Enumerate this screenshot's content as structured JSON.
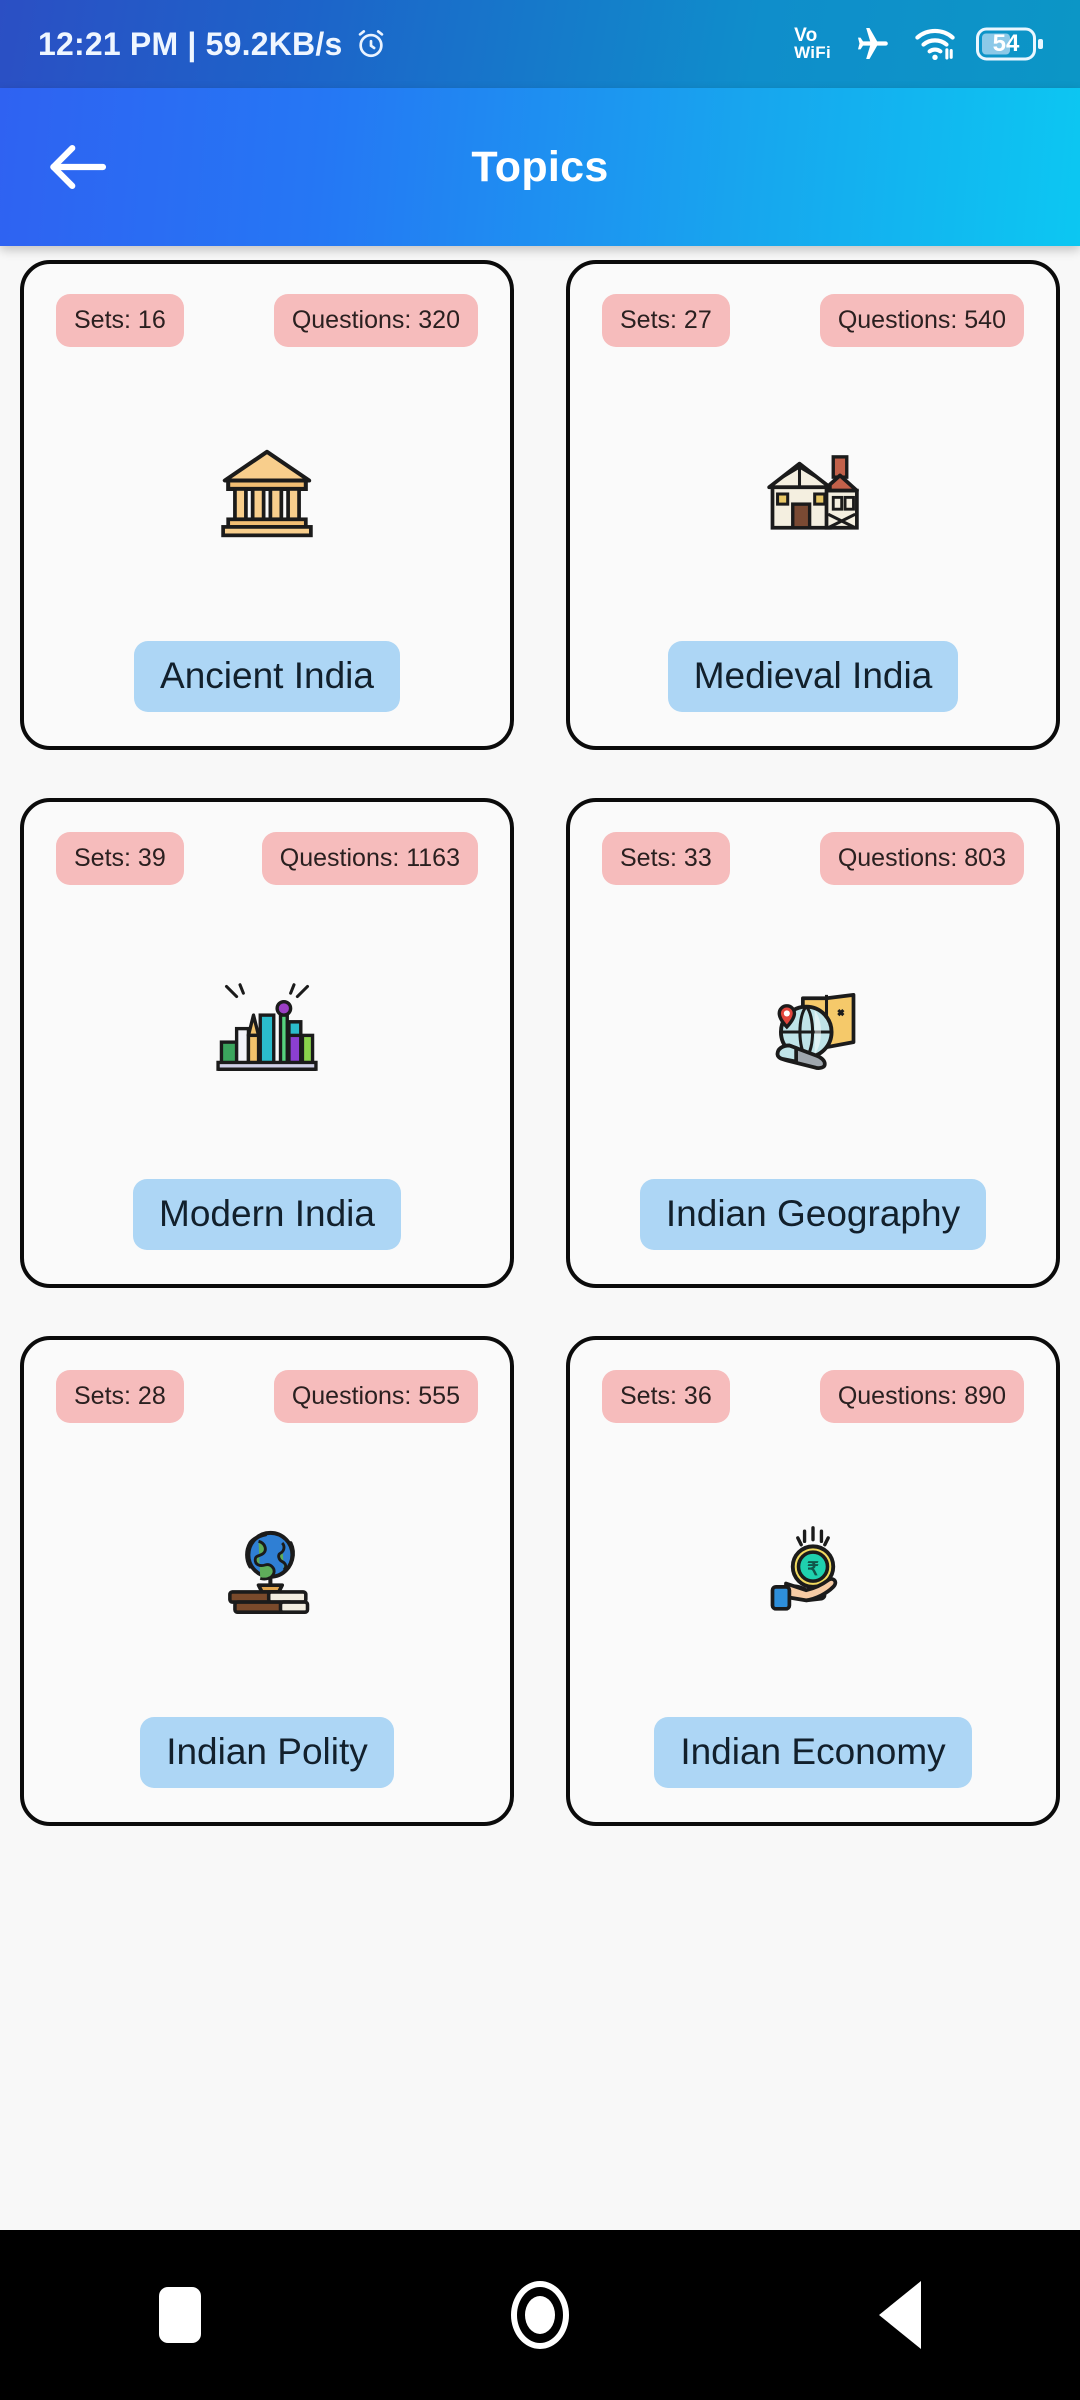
{
  "status_bar": {
    "time_and_speed": "12:21 PM | 59.2KB/s",
    "alarm_icon": "alarm-clock-icon",
    "vowifi_line1": "Vo",
    "vowifi_line2": "WiFi",
    "airplane_icon": "airplane-mode-icon",
    "wifi_icon": "wifi-icon",
    "battery_level": "54",
    "bg_color": "#1D63C9"
  },
  "app_bar": {
    "back_icon": "arrow-left-icon",
    "title": "Topics",
    "gradient_start": "#2F62F2",
    "gradient_end": "#0CC7F2"
  },
  "theme": {
    "page_bg": "#F8F8F8",
    "card_bg": "#FAFAFA",
    "card_border": "#0B0B0B",
    "stat_pill_bg": "#F6BCBC",
    "name_pill_bg": "#ADD6F5",
    "nav_bar_bg": "#000000"
  },
  "topics": [
    {
      "sets_label": "Sets: 16",
      "questions_label": "Questions: 320",
      "name": "Ancient India",
      "icon": "classical-building-icon"
    },
    {
      "sets_label": "Sets: 27",
      "questions_label": "Questions: 540",
      "name": "Medieval India",
      "icon": "medieval-house-icon"
    },
    {
      "sets_label": "Sets: 39",
      "questions_label": "Questions: 1163",
      "name": "Modern India",
      "icon": "city-skyline-icon"
    },
    {
      "sets_label": "Sets: 33",
      "questions_label": "Questions: 803",
      "name": "Indian Geography",
      "icon": "globe-map-telescope-icon"
    },
    {
      "sets_label": "Sets: 28",
      "questions_label": "Questions: 555",
      "name": "Indian Polity",
      "icon": "globe-on-books-icon"
    },
    {
      "sets_label": "Sets: 36",
      "questions_label": "Questions: 890",
      "name": "Indian Economy",
      "icon": "hand-rupee-coin-icon"
    }
  ],
  "nav_bar": {
    "recents_icon": "square-recents-icon",
    "home_icon": "circle-home-icon",
    "back_icon": "triangle-back-icon"
  }
}
